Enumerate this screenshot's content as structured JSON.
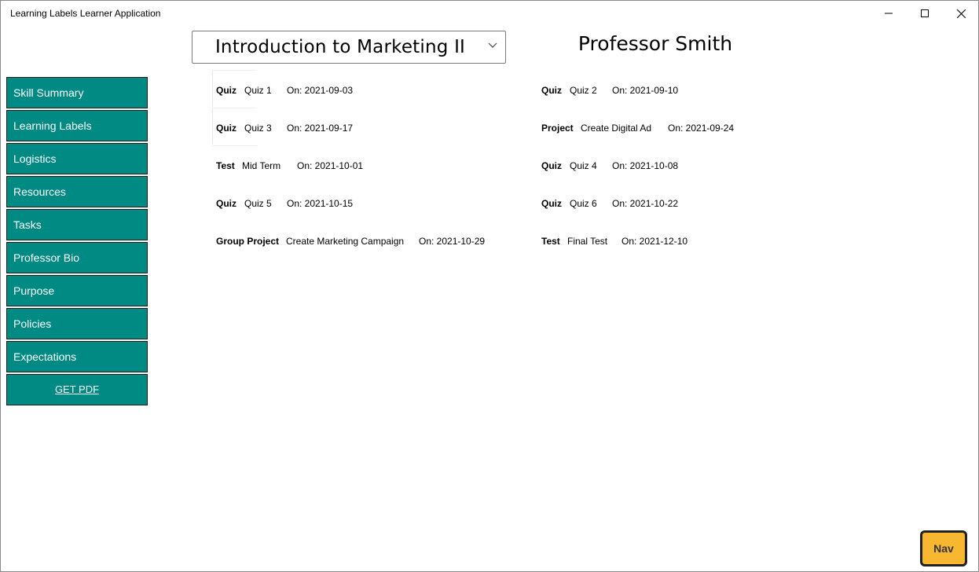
{
  "window": {
    "title": "Learning Labels Learner Application"
  },
  "header": {
    "course": "Introduction to Marketing II",
    "professor": "Professor Smith"
  },
  "sidebar": {
    "items": [
      {
        "label": "Skill Summary"
      },
      {
        "label": "Learning Labels"
      },
      {
        "label": "Logistics"
      },
      {
        "label": "Resources"
      },
      {
        "label": "Tasks"
      },
      {
        "label": "Professor Bio"
      },
      {
        "label": "Purpose"
      },
      {
        "label": "Policies"
      },
      {
        "label": "Expectations"
      }
    ],
    "pdf_label": "GET PDF"
  },
  "assessments": [
    {
      "type": "Quiz",
      "name": "Quiz 1",
      "date": "On: 2021-09-03"
    },
    {
      "type": "Quiz",
      "name": "Quiz 2",
      "date": "On: 2021-09-10"
    },
    {
      "type": "Quiz",
      "name": "Quiz 3",
      "date": "On: 2021-09-17"
    },
    {
      "type": "Project",
      "name": "Create Digital Ad",
      "date": "On: 2021-09-24"
    },
    {
      "type": "Test",
      "name": "Mid Term",
      "date": "On: 2021-10-01"
    },
    {
      "type": "Quiz",
      "name": "Quiz 4",
      "date": "On: 2021-10-08"
    },
    {
      "type": "Quiz",
      "name": "Quiz 5",
      "date": "On: 2021-10-15"
    },
    {
      "type": "Quiz",
      "name": "Quiz 6",
      "date": "On: 2021-10-22"
    },
    {
      "type": "Group Project",
      "name": "Create Marketing Campaign",
      "date": "On: 2021-10-29"
    },
    {
      "type": "Test",
      "name": "Final Test",
      "date": "On: 2021-12-10"
    }
  ],
  "nav_button": {
    "label": "Nav",
    "color": "#f7b731"
  },
  "colors": {
    "sidebar_button": "#008a84"
  },
  "icons": {
    "minimize": "minimize-icon",
    "maximize": "maximize-icon",
    "close": "close-icon",
    "dropdown": "chevron-down-icon"
  }
}
